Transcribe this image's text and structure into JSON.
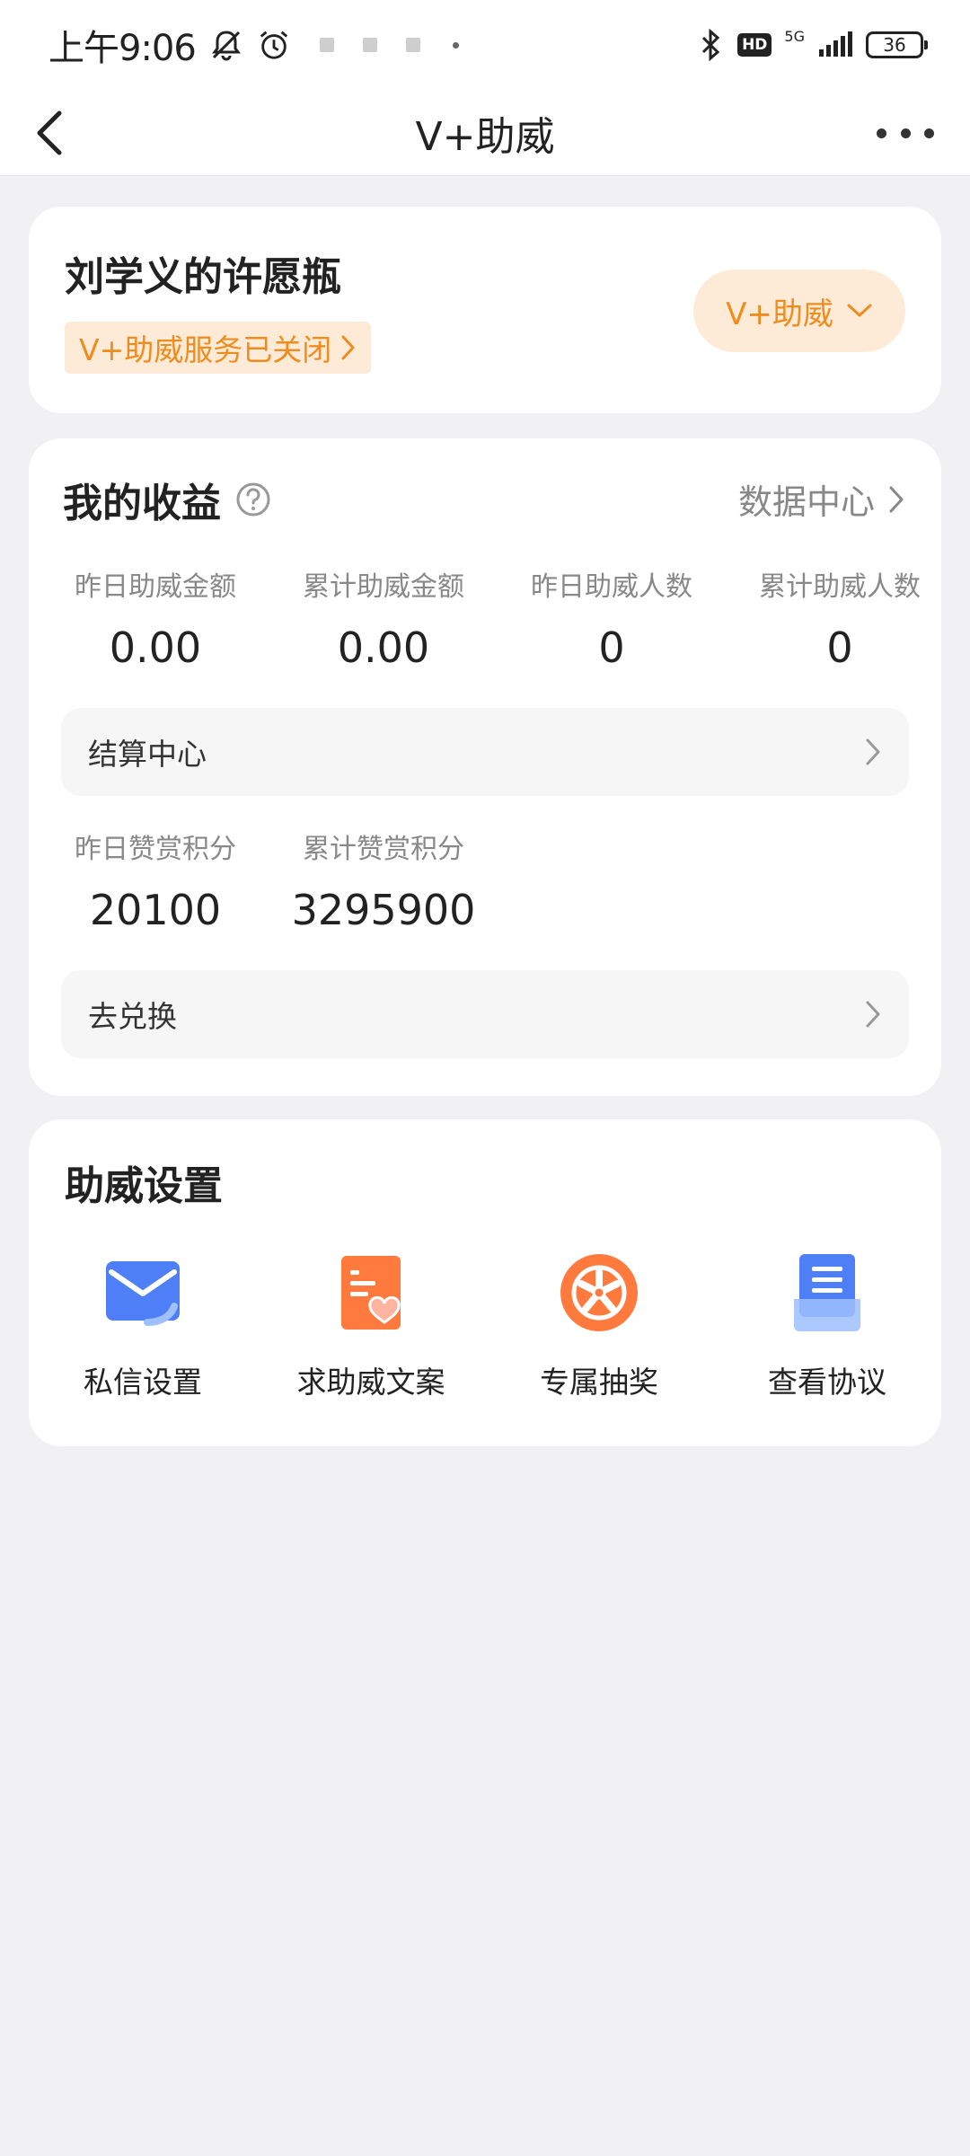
{
  "status_bar": {
    "time": "上午9:06",
    "network": "5G",
    "hd": "HD",
    "battery": "36"
  },
  "nav": {
    "title": "V+助威"
  },
  "profile": {
    "name": "刘学义的许愿瓶",
    "status": "V+助威服务已关闭",
    "switch_label": "V+助威"
  },
  "earnings": {
    "title": "我的收益",
    "data_center": "数据中心",
    "stats": [
      {
        "label": "昨日助威金额",
        "value": "0.00"
      },
      {
        "label": "累计助威金额",
        "value": "0.00"
      },
      {
        "label": "昨日助威人数",
        "value": "0"
      },
      {
        "label": "累计助威人数",
        "value": "0"
      }
    ],
    "settlement": "结算中心",
    "points": [
      {
        "label": "昨日赞赏积分",
        "value": "20100"
      },
      {
        "label": "累计赞赏积分",
        "value": "3295900"
      }
    ],
    "exchange": "去兑换"
  },
  "settings": {
    "title": "助威设置",
    "items": [
      {
        "label": "私信设置",
        "icon": "envelope-icon"
      },
      {
        "label": "求助威文案",
        "icon": "document-heart-icon"
      },
      {
        "label": "专属抽奖",
        "icon": "lottery-wheel-icon"
      },
      {
        "label": "查看协议",
        "icon": "agreement-icon"
      }
    ]
  },
  "colors": {
    "accent": "#f08c1e",
    "accent_bg": "#fdebd8",
    "background": "#f1f1f3"
  }
}
